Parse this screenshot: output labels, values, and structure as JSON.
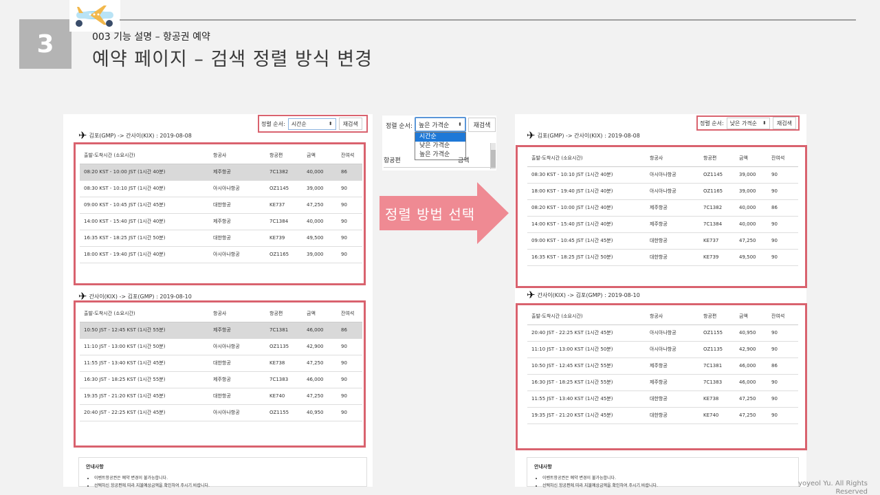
{
  "header": {
    "slide_number": "3",
    "subtitle": "003 기능 설명 – 항공권 예약",
    "title": "예약 페이지 – 검색 정렬 방식 변경"
  },
  "arrow_label": "정렬 방법 선택",
  "footer": "yoyeol Yu. All Rights Reserved",
  "colors": {
    "highlight_border": "#d9626e",
    "arrow": "#ef8a93",
    "selected_option": "#1e78d7"
  },
  "left": {
    "sort_label": "정렬 순서:",
    "sort_value": "시간순",
    "research_button": "재검색",
    "outbound_route": "김포(GMP) -> 간사이(KIX) : 2019-08-08",
    "return_route": "간사이(KIX) -> 김포(GMP) : 2019-08-10",
    "columns": [
      "출발-도착시간 (소요시간)",
      "항공사",
      "항공편",
      "금액",
      "잔여석"
    ],
    "outbound_rows": [
      [
        "08:20 KST - 10:00 JST (1시간 40분)",
        "제주항공",
        "7C1382",
        "40,000",
        "86"
      ],
      [
        "08:30 KST - 10:10 JST (1시간 40분)",
        "아시아나항공",
        "OZ1145",
        "39,000",
        "90"
      ],
      [
        "09:00 KST - 10:45 JST (1시간 45분)",
        "대한항공",
        "KE737",
        "47,250",
        "90"
      ],
      [
        "14:00 KST - 15:40 JST (1시간 40분)",
        "제주항공",
        "7C1384",
        "40,000",
        "90"
      ],
      [
        "16:35 KST - 18:25 JST (1시간 50분)",
        "대한항공",
        "KE739",
        "49,500",
        "90"
      ],
      [
        "18:00 KST - 19:40 JST (1시간 40분)",
        "아시아나항공",
        "OZ1165",
        "39,000",
        "90"
      ]
    ],
    "return_rows": [
      [
        "10:50 JST - 12:45 KST (1시간 55분)",
        "제주항공",
        "7C1381",
        "46,000",
        "86"
      ],
      [
        "11:10 JST - 13:00 KST (1시간 50분)",
        "아시아나항공",
        "OZ1135",
        "42,900",
        "90"
      ],
      [
        "11:55 JST - 13:40 KST (1시간 45분)",
        "대한항공",
        "KE738",
        "47,250",
        "90"
      ],
      [
        "16:30 JST - 18:25 KST (1시간 55분)",
        "제주항공",
        "7C1383",
        "46,000",
        "90"
      ],
      [
        "19:35 JST - 21:20 KST (1시간 45분)",
        "대한항공",
        "KE740",
        "47,250",
        "90"
      ],
      [
        "20:40 JST - 22:25 KST (1시간 45분)",
        "아시아나항공",
        "OZ1155",
        "40,950",
        "90"
      ]
    ],
    "notice_title": "안내사항",
    "notice_items": [
      "이벤트항공권은 예약 변경이 불가능합니다.",
      "선택하신 항공편에 따라 지불예상금액을 확인하여 주시기 바랍니다."
    ]
  },
  "middle": {
    "sort_label": "정렬 순서:",
    "sort_value": "높은 가격순",
    "research_button": "재검색",
    "options": [
      "시간순",
      "낮은 가격순",
      "높은 가격순"
    ],
    "partial_header": [
      "항공편",
      "금액"
    ]
  },
  "right": {
    "sort_label": "정렬 순서:",
    "sort_value": "낮은 가격순",
    "research_button": "재검색",
    "outbound_route": "김포(GMP) -> 간사이(KIX) : 2019-08-08",
    "return_route": "간사이(KIX) -> 김포(GMP) : 2019-08-10",
    "columns": [
      "출발-도착시간 (소요시간)",
      "항공사",
      "항공편",
      "금액",
      "잔여석"
    ],
    "outbound_rows": [
      [
        "08:30 KST - 10:10 JST (1시간 40분)",
        "아시아나항공",
        "OZ1145",
        "39,000",
        "90"
      ],
      [
        "18:00 KST - 19:40 JST (1시간 40분)",
        "아시아나항공",
        "OZ1165",
        "39,000",
        "90"
      ],
      [
        "08:20 KST - 10:00 JST (1시간 40분)",
        "제주항공",
        "7C1382",
        "40,000",
        "86"
      ],
      [
        "14:00 KST - 15:40 JST (1시간 40분)",
        "제주항공",
        "7C1384",
        "40,000",
        "90"
      ],
      [
        "09:00 KST - 10:45 JST (1시간 45분)",
        "대한항공",
        "KE737",
        "47,250",
        "90"
      ],
      [
        "16:35 KST - 18:25 JST (1시간 50분)",
        "대한항공",
        "KE739",
        "49,500",
        "90"
      ]
    ],
    "return_rows": [
      [
        "20:40 JST - 22:25 KST (1시간 45분)",
        "아시아나항공",
        "OZ1155",
        "40,950",
        "90"
      ],
      [
        "11:10 JST - 13:00 KST (1시간 50분)",
        "아시아나항공",
        "OZ1135",
        "42,900",
        "90"
      ],
      [
        "10:50 JST - 12:45 KST (1시간 55분)",
        "제주항공",
        "7C1381",
        "46,000",
        "86"
      ],
      [
        "16:30 JST - 18:25 KST (1시간 55분)",
        "제주항공",
        "7C1383",
        "46,000",
        "90"
      ],
      [
        "11:55 JST - 13:40 KST (1시간 45분)",
        "대한항공",
        "KE738",
        "47,250",
        "90"
      ],
      [
        "19:35 JST - 21:20 KST (1시간 45분)",
        "대한항공",
        "KE740",
        "47,250",
        "90"
      ]
    ],
    "notice_title": "안내사항",
    "notice_items": [
      "이벤트항공권은 예약 변경이 불가능합니다.",
      "선택하신 항공편에 따라 지불예상금액을 확인하여 주시기 바랍니다."
    ]
  }
}
